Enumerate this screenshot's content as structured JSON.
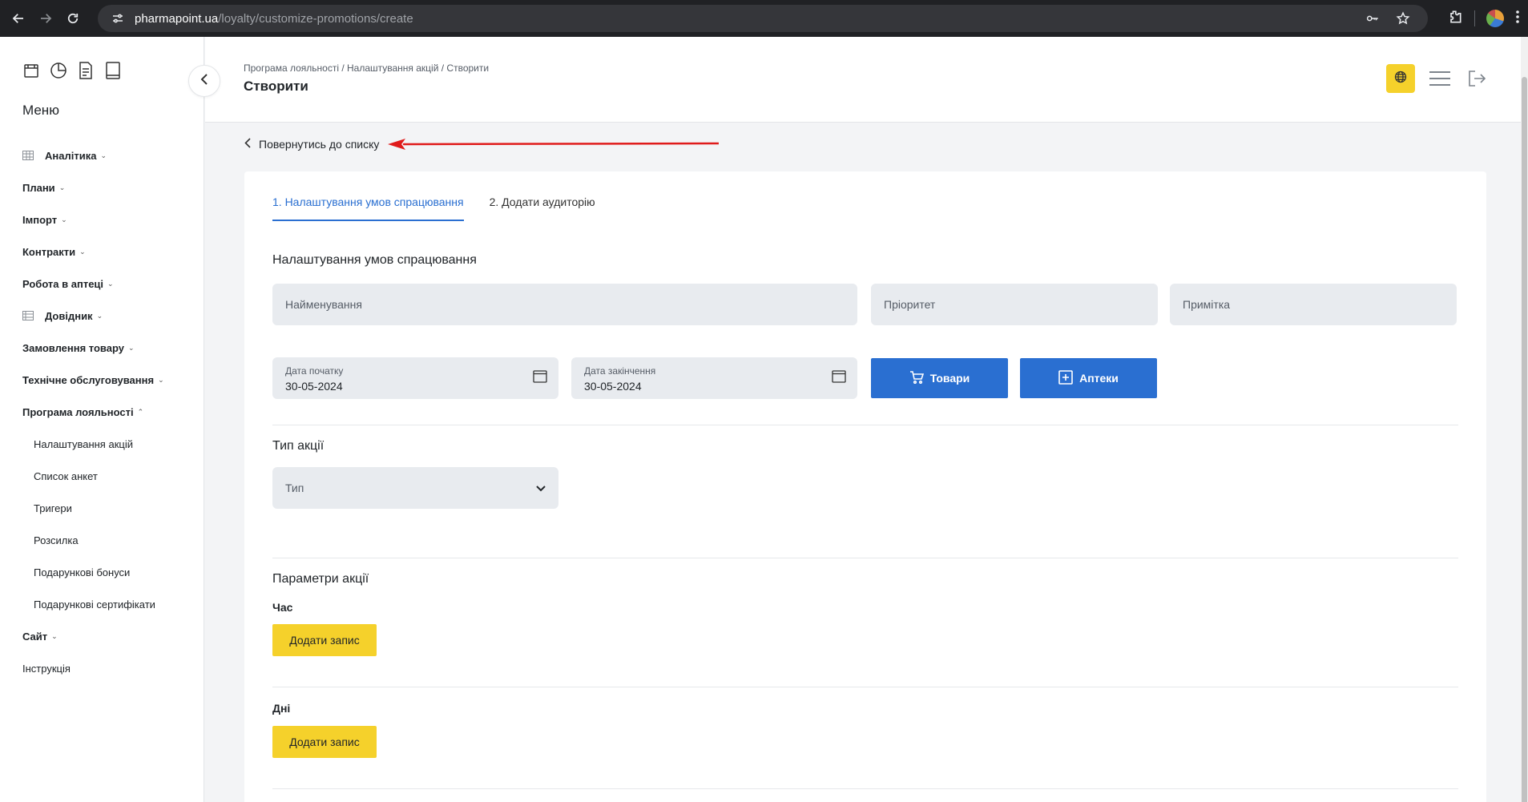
{
  "browser": {
    "url_host": "pharmapoint.ua",
    "url_path": "/loyalty/customize-promotions/create"
  },
  "sidebar": {
    "menu_title": "Меню",
    "items": [
      {
        "label": "Аналітика",
        "icon": "table-icon"
      },
      {
        "label": "Плани"
      },
      {
        "label": "Імпорт"
      },
      {
        "label": "Контракти"
      },
      {
        "label": "Робота в аптеці"
      },
      {
        "label": "Довідник",
        "icon": "list-icon"
      },
      {
        "label": "Замовлення товару"
      },
      {
        "label": "Технічне обслуговування"
      },
      {
        "label": "Програма лояльності"
      }
    ],
    "loyalty_sub": [
      "Налаштування акцій",
      "Список анкет",
      "Тригери",
      "Розсилка",
      "Подарункові бонуси",
      "Подарункові сертифікати"
    ],
    "site": "Сайт",
    "instruction": "Інструкція"
  },
  "header": {
    "breadcrumb": "Програма лояльності / Налаштування акцій / Створити",
    "title": "Створити"
  },
  "main": {
    "back_link": "Повернутись до списку",
    "tabs": [
      "1. Налаштування умов спрацювання",
      "2. Додати аудиторію"
    ],
    "conditions_title": "Налаштування умов спрацювання",
    "fields": {
      "name_placeholder": "Найменування",
      "priority_placeholder": "Пріоритет",
      "note_placeholder": "Примітка"
    },
    "start_date": {
      "label": "Дата початку",
      "value": "30-05-2024"
    },
    "end_date": {
      "label": "Дата закінчення",
      "value": "30-05-2024"
    },
    "goods_button": "Товари",
    "pharmacies_button": "Аптеки",
    "action_type_title": "Тип акції",
    "type_select": "Тип",
    "params_title": "Параметри акції",
    "time_label": "Час",
    "days_label": "Дні",
    "add_record": "Додати запис"
  },
  "colors": {
    "accent_blue": "#2a6fd1",
    "accent_yellow": "#f5d12b",
    "arrow_red": "#e01b1b"
  }
}
